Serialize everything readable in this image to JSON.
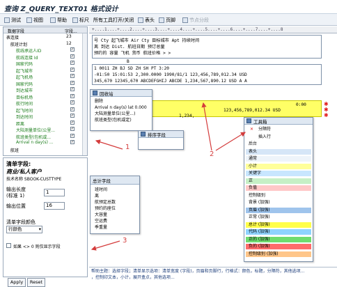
{
  "window": {
    "title": "查询 Z_QUERY_TEXT01 格式设计"
  },
  "toolbar": {
    "items": [
      "测试",
      "视图",
      "帮助",
      "标尺",
      "所有工具打开/关闭",
      "表头",
      "页脚",
      "节点分段"
    ]
  },
  "tree": {
    "header_col1": "数据字段",
    "header_col2": "字段...",
    "rows": [
      {
        "label": "表连接",
        "num": "23",
        "checked": false
      },
      {
        "label": "航班计划",
        "num": "12",
        "checked": false
      },
      {
        "label": "航线承运人ID",
        "num": "",
        "checked": true
      },
      {
        "label": "航线连接 Id",
        "num": "",
        "checked": true
      },
      {
        "label": "国家代码",
        "num": "",
        "checked": true
      },
      {
        "label": "起飞城市",
        "num": "",
        "checked": true
      },
      {
        "label": "起飞机场",
        "num": "",
        "checked": true
      },
      {
        "label": "国家代码",
        "num": "",
        "checked": true
      },
      {
        "label": "到达城市",
        "num": "",
        "checked": true
      },
      {
        "label": "目标机场",
        "num": "",
        "checked": true
      },
      {
        "label": "航行时间",
        "num": "",
        "checked": true
      },
      {
        "label": "起飞时间",
        "num": "",
        "checked": true
      },
      {
        "label": "到达时间",
        "num": "",
        "checked": true
      },
      {
        "label": "距离",
        "num": "",
        "checked": true
      },
      {
        "label": "大陆测量单位(公里...",
        "num": "",
        "checked": true
      },
      {
        "label": "航班类型(包机或...",
        "num": "",
        "checked": true
      },
      {
        "label": "Arrival n day(s) ...",
        "num": "",
        "checked": true
      },
      {
        "label": "航班",
        "num": "",
        "checked": false
      }
    ]
  },
  "attributes": {
    "heading": "清单字段:",
    "object_title": "商业/私人客户",
    "tech_name": "技术名称 SBOOK-CUSTTYPE",
    "output_length_label": "输出长度",
    "output_length_sub": "(标准 1)",
    "output_length_value": "1",
    "output_pos_label": "输出位置",
    "output_pos_value": "16",
    "color_label": "清单字段颜色",
    "color_value": "行颜色",
    "suppress_label": "如果 <> 0 则仅显示字段",
    "apply_label": "Apply",
    "reset_label": "Reset"
  },
  "ruler": {
    "text": "+....1....+....2....+....3....+....4....+....5....+....6....+....7....+....8"
  },
  "report": {
    "header_lines": [
      "号    Cty  起飞城市         Air Cty 目标城市             Apt 持续时间",
      "离      到达      Dist.     航班日期    预订总量",
      "预约的      容量          飞机       货币   航班价格                  > >"
    ],
    "header_marker": "B",
    "detail_lines": [
      "1 0011 ZH  BJ                  SD  ZH  SH              PT    3:20",
      "-01:50 15:01:53 2,300.0000      1990/81/1      123,456,789,012.34  USD",
      "345,670  12345,670  ABCDEFGHIJ ABCDE    1,234,567,890.12  USD   A  A"
    ],
    "total_line": "0:00",
    "total_amount": "123,456,789,012.34 USD",
    "total_amount2": "1,234,"
  },
  "popups": {
    "recycle": {
      "title": "回收站",
      "items": [
        "删除",
        "Arrival n day(s) lat 0.000",
        "大陆测量单位(公里...)",
        "航班类型(包机或定)"
      ]
    },
    "sort": {
      "title": "排序字段"
    },
    "total": {
      "title": "总计字段",
      "items": [
        "班时间",
        "离",
        "航预定总数",
        "预约的座位",
        "大容量",
        "空运费",
        "季重量"
      ]
    },
    "toolbox": {
      "title": "工具箱",
      "items": [
        {
          "label": "分隔符",
          "color": "#ffffff"
        },
        {
          "label": "插入行",
          "color": "#ffffff"
        },
        {
          "label": "后台",
          "color": "#ffffff"
        },
        {
          "label": "表头",
          "color": "#d6e6f7"
        },
        {
          "label": "通常",
          "color": "#eef4fa"
        },
        {
          "label": "小计",
          "color": "#ffff9a"
        },
        {
          "label": "关键字",
          "color": "#c8e6ff"
        },
        {
          "label": "正",
          "color": "#c6f0c6"
        },
        {
          "label": "负值",
          "color": "#ffc8c8"
        },
        {
          "label": "控制级别",
          "color": "#ffffff"
        },
        {
          "label": "背景 (加强)",
          "color": "#ffffff"
        },
        {
          "label": "页眉 (加强)",
          "color": "#9fc4ec"
        },
        {
          "label": "正常 (加强)",
          "color": "#ffffff"
        },
        {
          "label": "总计 (加强)",
          "color": "#ffff4a"
        },
        {
          "label": "代码 (加强)",
          "color": "#8fd3ff"
        },
        {
          "label": "正的 (加强)",
          "color": "#6fdc6f"
        },
        {
          "label": "负的 (加强)",
          "color": "#ff6b6b"
        },
        {
          "label": "控制级别 (加强)",
          "color": "#ffc68a"
        }
      ]
    }
  },
  "help": {
    "line1": "帮助主题：选择字段；清单显示选项：清单宽度 (字段)，页眉和页脚行，行格式：颜色，标题，分隔符，其他选项...",
    "line2": "，控制印文本，小计，展开盒点，其他选项..."
  },
  "callouts": [
    "1",
    "2",
    "3"
  ],
  "colors": {
    "accent": "#d43c3c",
    "yellow": "#ffff66"
  }
}
